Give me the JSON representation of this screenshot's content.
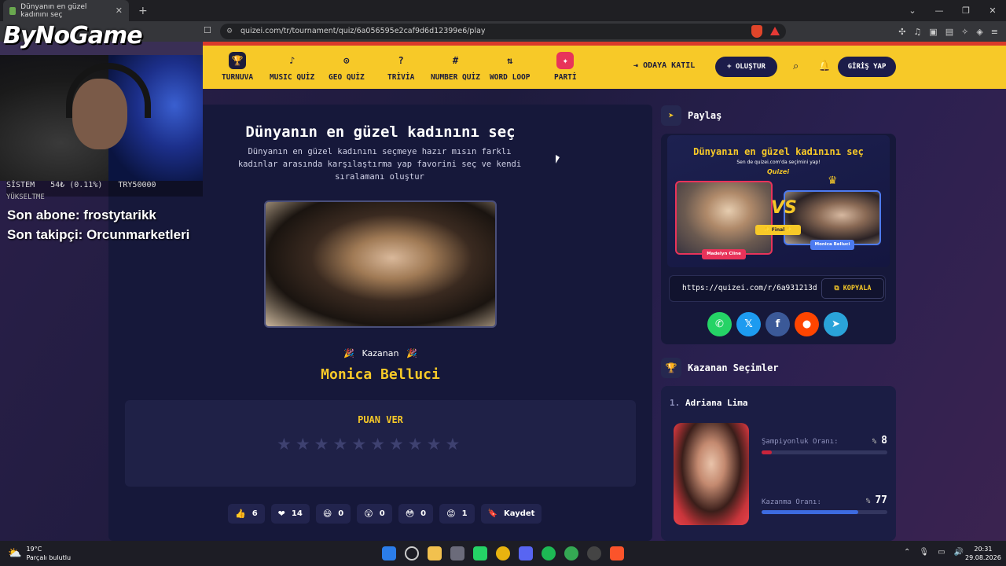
{
  "browser": {
    "tab_title": "Dünyanın en güzel kadınını seç",
    "url": "quizei.com/tr/tournament/quiz/6a056595e2caf9d6d12399e6/play"
  },
  "nav": {
    "items": [
      {
        "label": "TURNUVA",
        "icon": "trophy-icon"
      },
      {
        "label": "MUSIC QUİZ",
        "icon": "music-note-icon"
      },
      {
        "label": "GEO QUİZ",
        "icon": "map-pin-icon"
      },
      {
        "label": "TRİVİA",
        "icon": "question-icon"
      },
      {
        "label": "NUMBER QUİZ",
        "icon": "hash-icon"
      },
      {
        "label": "WORD LOOP",
        "icon": "sort-icon"
      },
      {
        "label": "PARTİ",
        "icon": "party-icon"
      }
    ],
    "join_label": "ODAYA KATIL",
    "create_label": "+ OLUŞTUR",
    "login_label": "GİRİŞ YAP"
  },
  "quiz": {
    "title": "Dünyanın en güzel kadınını seç",
    "description": "Dünyanın en güzel kadınını seçmeye hazır mısın farklı kadınlar arasında karşılaştırma yap favorini seç ve kendi sıralamanı oluştur",
    "winner_label": "Kazanan",
    "winner_name": "Monica Belluci",
    "rate_label": "PUAN VER",
    "star_count": 10,
    "reactions": [
      {
        "emoji": "👍",
        "count": "6"
      },
      {
        "emoji": "❤",
        "count": "14"
      },
      {
        "emoji": "😄",
        "count": "0"
      },
      {
        "emoji": "😲",
        "count": "0"
      },
      {
        "emoji": "😳",
        "count": "0"
      },
      {
        "emoji": "😡",
        "count": "1"
      }
    ],
    "save_label": "Kaydet"
  },
  "share": {
    "heading": "Paylaş",
    "card_title": "Dünyanın en güzel kadınını seç",
    "card_subtitle": "Sen de quizei.com'da seçimini yap!",
    "card_logo": "Quizei",
    "vs_text": "VS",
    "final_label": "✨ Final ✨",
    "candidate_left": "Madelyn Cline",
    "candidate_right": "Monica Belluci",
    "link": "https://quizei.com/r/6a931213d",
    "copy_label": "KOPYALA",
    "socials": [
      "whatsapp-icon",
      "x-icon",
      "facebook-icon",
      "reddit-icon",
      "telegram-icon"
    ]
  },
  "winners": {
    "heading": "Kazanan Seçimler",
    "items": [
      {
        "rank": "1.",
        "name": "Adriana Lima",
        "champ_label": "Şampiyonluk Oranı:",
        "champ_pct_sign": "%",
        "champ_value": "8",
        "champ_fraction": 0.08,
        "win_label": "Kazanma Oranı:",
        "win_pct_sign": "%",
        "win_value": "77",
        "win_fraction": 0.77
      }
    ]
  },
  "overlay": {
    "logo": "ByNoGame",
    "sys_label": "SİSTEM",
    "sys_value": "54₺ (0.11%)",
    "sys_goal": "TRY50000",
    "sys_sub": "YÜKSELTME",
    "last_sub": "Son abone: frostytarikk",
    "last_follow": "Son takipçi: Orcunmarketleri"
  },
  "taskbar": {
    "temp": "19°C",
    "weather": "Parçalı bulutlu",
    "time": "20:31",
    "date": "29.08.2026"
  },
  "colors": {
    "accent": "#f7c928",
    "nav_border": "#d93a2b",
    "panel": "#16183a",
    "champ_bar": "#c9243b",
    "win_bar": "#3d6be0"
  }
}
